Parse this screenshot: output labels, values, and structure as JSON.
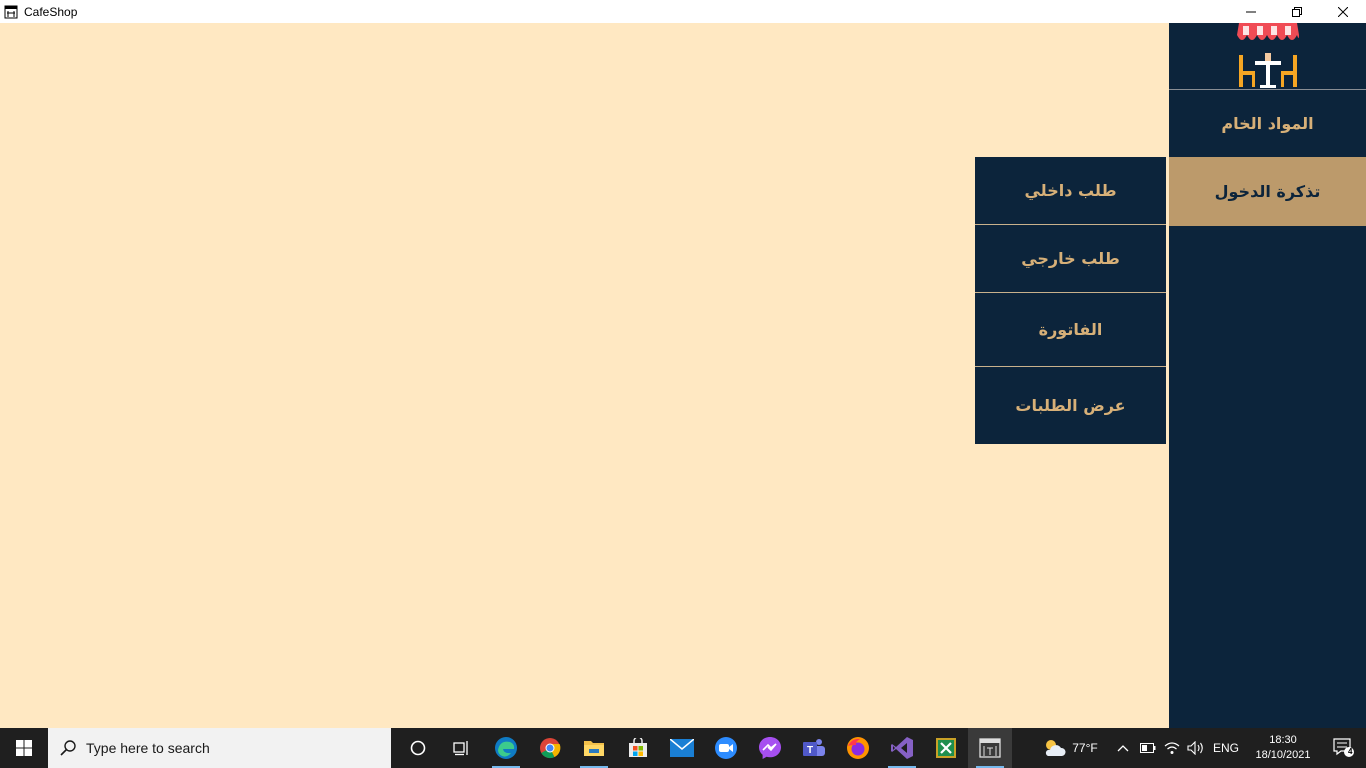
{
  "window": {
    "title": "CafeShop"
  },
  "sidebar": {
    "logo_icon": "cafe-table-awning-icon",
    "items": [
      {
        "label": "المواد الخام",
        "active": false
      },
      {
        "label": "تذكرة الدخول",
        "active": true
      }
    ]
  },
  "submenu": {
    "items": [
      {
        "label": "طلب داخلي"
      },
      {
        "label": "طلب خارجي"
      },
      {
        "label": "الفاتورة"
      },
      {
        "label": "عرض الطلبات"
      }
    ]
  },
  "colors": {
    "background": "#ffe8c2",
    "navy": "#0c243b",
    "gold_text": "#d7b078",
    "active_tan": "#bc9a6b"
  },
  "taskbar": {
    "search_placeholder": "Type here to search",
    "pinned": [
      "cortana-icon",
      "task-view-icon",
      "edge-icon",
      "chrome-icon",
      "file-explorer-icon",
      "store-icon",
      "mail-icon",
      "zoom-icon",
      "messenger-icon",
      "teams-icon",
      "firefox-icon",
      "visual-studio-icon",
      "excel-like-icon",
      "cafeshop-app-icon"
    ],
    "weather": "77°F",
    "language": "ENG",
    "time": "18:30",
    "date": "18/10/2021",
    "notification_count": "4"
  }
}
